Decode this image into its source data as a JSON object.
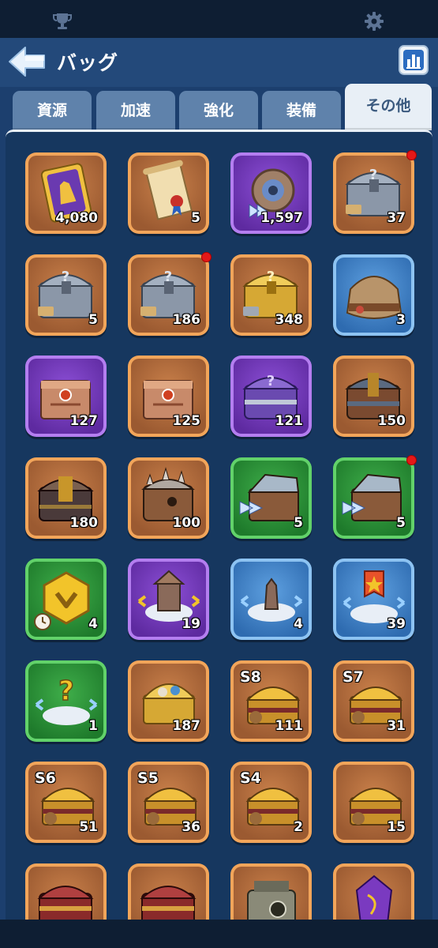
{
  "header": {
    "title": "バッグ"
  },
  "tabs": [
    {
      "label": "資源",
      "active": false
    },
    {
      "label": "加速",
      "active": false
    },
    {
      "label": "強化",
      "active": false
    },
    {
      "label": "装備",
      "active": false
    },
    {
      "label": "その他",
      "active": true
    }
  ],
  "items": [
    {
      "icon": "golden-ticket-icon",
      "color": "orange",
      "count": "4,080"
    },
    {
      "icon": "scroll-icon",
      "color": "orange",
      "count": "5"
    },
    {
      "icon": "speedup-shield-icon",
      "color": "purple",
      "count": "1,597"
    },
    {
      "icon": "mystery-silver-chest-icon",
      "color": "orange",
      "count": "37",
      "new": true
    },
    {
      "icon": "mystery-silver-chest-icon",
      "color": "orange",
      "count": "5"
    },
    {
      "icon": "mystery-silver-chest-icon",
      "color": "orange",
      "count": "186",
      "new": true
    },
    {
      "icon": "mystery-gold-chest-icon",
      "color": "orange",
      "count": "348"
    },
    {
      "icon": "sack-icon",
      "color": "blue",
      "count": "3"
    },
    {
      "icon": "bronze-chest-icon",
      "color": "purple",
      "count": "127"
    },
    {
      "icon": "bronze-chest-icon",
      "color": "orange",
      "count": "125"
    },
    {
      "icon": "purple-mystery-chest-icon",
      "color": "purple",
      "count": "121"
    },
    {
      "icon": "iron-chest-icon",
      "color": "orange",
      "count": "150"
    },
    {
      "icon": "dark-chest-icon",
      "color": "orange",
      "count": "180"
    },
    {
      "icon": "spiked-chest-icon",
      "color": "orange",
      "count": "100"
    },
    {
      "icon": "speedup-chest-icon",
      "color": "green",
      "count": "5"
    },
    {
      "icon": "speedup-chest-icon",
      "color": "green",
      "count": "5",
      "new": true
    },
    {
      "icon": "gold-badge-timer-icon",
      "color": "green",
      "count": "4"
    },
    {
      "icon": "building-relocate-icon",
      "color": "purple",
      "count": "19"
    },
    {
      "icon": "statue-relocate-icon",
      "color": "blue",
      "count": "4"
    },
    {
      "icon": "banner-relocate-icon",
      "color": "blue",
      "count": "39"
    },
    {
      "icon": "random-relocate-icon",
      "color": "green",
      "count": "1"
    },
    {
      "icon": "treasure-chest-icon",
      "color": "orange",
      "count": "187"
    },
    {
      "icon": "season-chest-icon",
      "color": "orange",
      "count": "111",
      "season": "S8"
    },
    {
      "icon": "season-chest-icon",
      "color": "orange",
      "count": "31",
      "season": "S7"
    },
    {
      "icon": "season-chest-icon",
      "color": "orange",
      "count": "51",
      "season": "S6"
    },
    {
      "icon": "season-chest-icon",
      "color": "orange",
      "count": "36",
      "season": "S5"
    },
    {
      "icon": "season-chest-icon",
      "color": "orange",
      "count": "2",
      "season": "S4"
    },
    {
      "icon": "season-chest-icon",
      "color": "orange",
      "count": "15"
    },
    {
      "icon": "red-chest-icon",
      "color": "orange",
      "count": ""
    },
    {
      "icon": "red-chest-icon",
      "color": "orange",
      "count": ""
    },
    {
      "icon": "device-icon",
      "color": "orange",
      "count": ""
    },
    {
      "icon": "purple-crystal-icon",
      "color": "orange",
      "count": ""
    }
  ]
}
